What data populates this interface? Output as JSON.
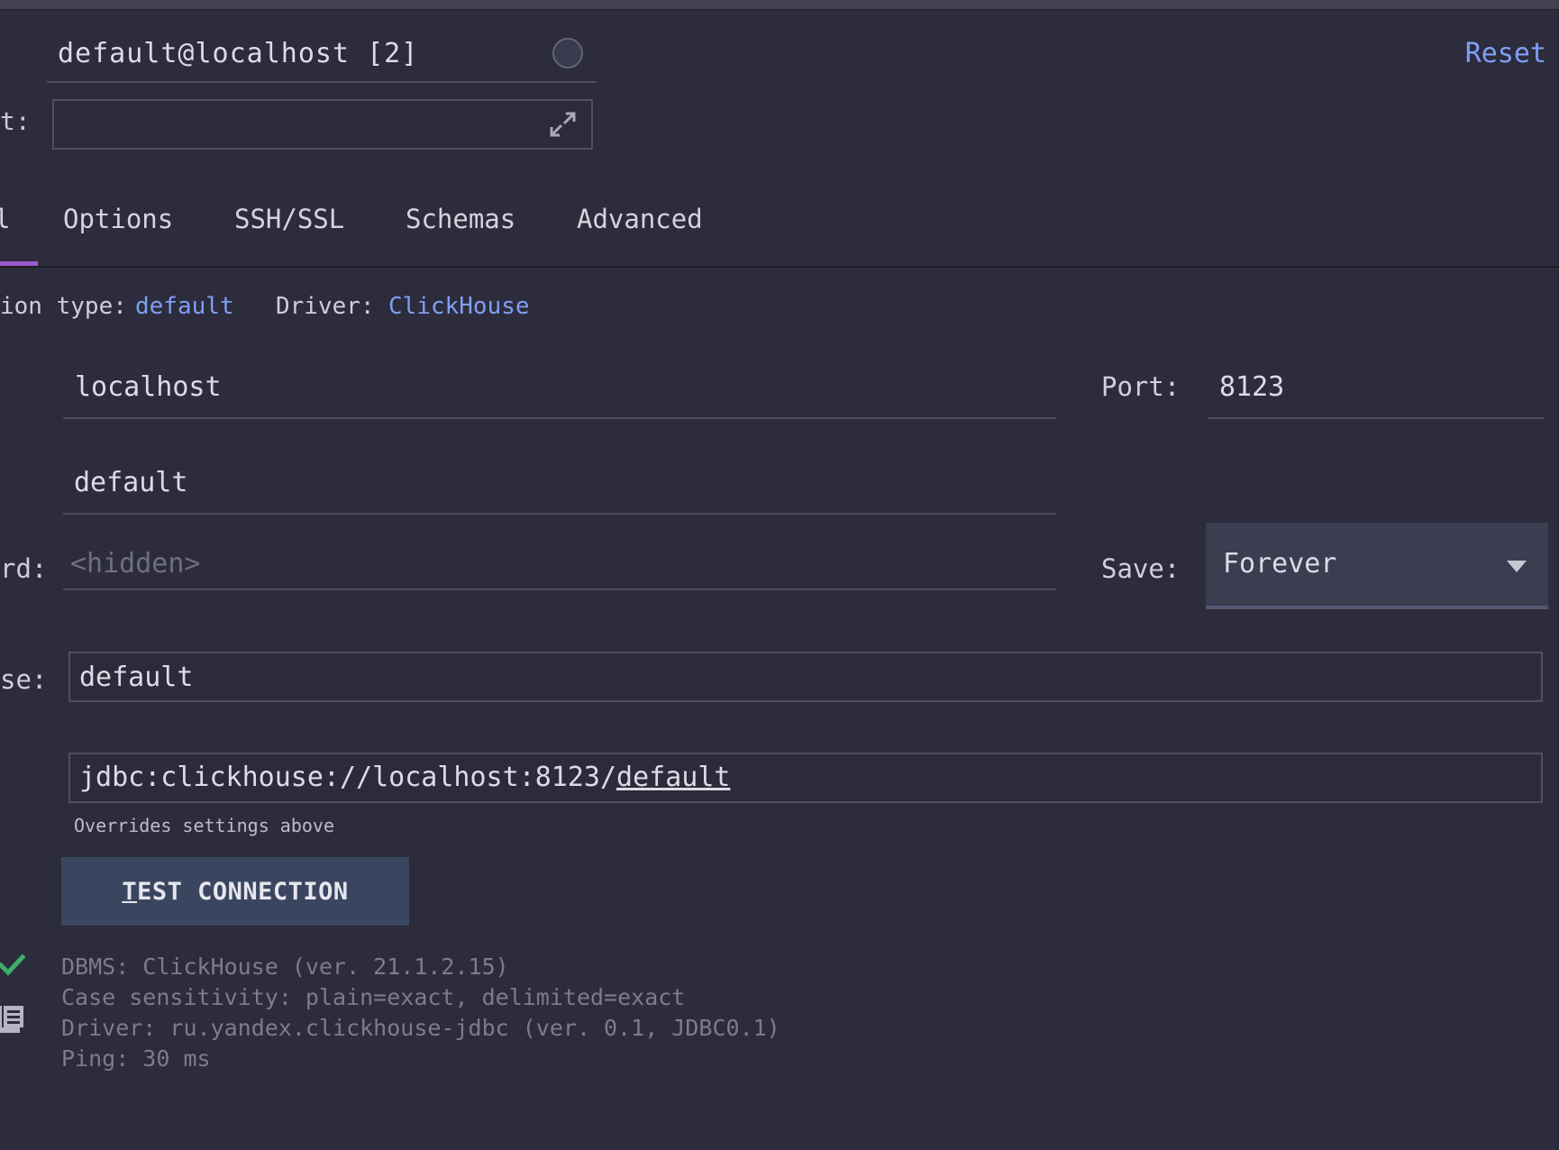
{
  "connection": {
    "name": "default@localhost [2]",
    "reset_label": "Reset",
    "comment_label_partial": "t:",
    "comment_value": ""
  },
  "tabs": {
    "main_partial": "l",
    "items": [
      "Options",
      "SSH/SSL",
      "Schemas",
      "Advanced"
    ]
  },
  "info": {
    "connection_type_label": "ion type:",
    "connection_type_value": "default",
    "driver_label": "Driver:",
    "driver_value": "ClickHouse"
  },
  "fields": {
    "host_value": "localhost",
    "port_label": "Port:",
    "port_value": "8123",
    "user_value": "default",
    "password_label_partial": "rd:",
    "password_placeholder": "<hidden>",
    "save_label": "Save:",
    "save_value": "Forever",
    "database_label_partial": "se:",
    "database_value": "default",
    "url_prefix": "jdbc:clickhouse://localhost:8123/",
    "url_db": "default",
    "url_note": "Overrides settings above"
  },
  "test_button": {
    "mnemonic": "T",
    "rest": "EST CONNECTION"
  },
  "result": {
    "lines": [
      "DBMS: ClickHouse (ver. 21.1.2.15)",
      "Case sensitivity: plain=exact, delimited=exact",
      "Driver: ru.yandex.clickhouse-jdbc (ver. 0.1, JDBC0.1)",
      "Ping: 30 ms"
    ]
  },
  "colors": {
    "background": "#2c2c3c",
    "link": "#7f9ef5",
    "tab_accent": "#9b59d0",
    "success": "#3fae6a",
    "button": "#3a4660"
  },
  "icons": [
    "expand-icon",
    "color-circle",
    "check-icon",
    "copy-icon",
    "dropdown-caret-icon"
  ]
}
